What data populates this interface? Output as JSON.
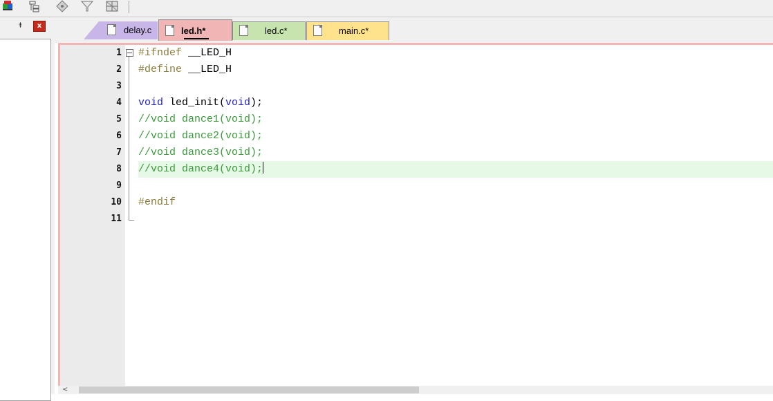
{
  "toolbar": {
    "icons": [
      "project-window-icon",
      "hierarchy-icon",
      "diamond-tool-icon",
      "filter-icon",
      "grid-icon"
    ]
  },
  "left_panel": {
    "pin_glyph": "⯒",
    "close_glyph": "x"
  },
  "tabs": [
    {
      "label": "delay.c",
      "color": "#c8b6e8",
      "active": false
    },
    {
      "label": "led.h*",
      "color": "#f2b5b5",
      "active": true
    },
    {
      "label": "led.c*",
      "color": "#c7e4ae",
      "active": false
    },
    {
      "label": "main.c*",
      "color": "#ffe28c",
      "active": false
    }
  ],
  "editor": {
    "line_numbers": [
      "1",
      "2",
      "3",
      "4",
      "5",
      "6",
      "7",
      "8",
      "9",
      "10",
      "11"
    ],
    "highlighted_line": 8,
    "lines": [
      {
        "pp": "#ifndef",
        "rest": " __LED_H"
      },
      {
        "pp": "#define",
        "rest": " __LED_H"
      },
      {
        "pp": "",
        "rest": ""
      },
      {
        "kw1": "void",
        "mid": " led_init(",
        "kw2": "void",
        "end": ");"
      },
      {
        "cm": "//void dance1(void);"
      },
      {
        "cm": "//void dance2(void);"
      },
      {
        "cm": "//void dance3(void);"
      },
      {
        "cm": "//void dance4(void);"
      },
      {
        "pp": "",
        "rest": ""
      },
      {
        "pp": "#endif",
        "rest": ""
      },
      {
        "pp": "",
        "rest": ""
      }
    ]
  },
  "scrollbar": {
    "left_arrow": "<"
  },
  "colors": {
    "keyword": "#1f1fc8",
    "preprocessor": "#8b7b3a",
    "comment": "#3a9a3a",
    "line_highlight": "#e6f9e6"
  }
}
